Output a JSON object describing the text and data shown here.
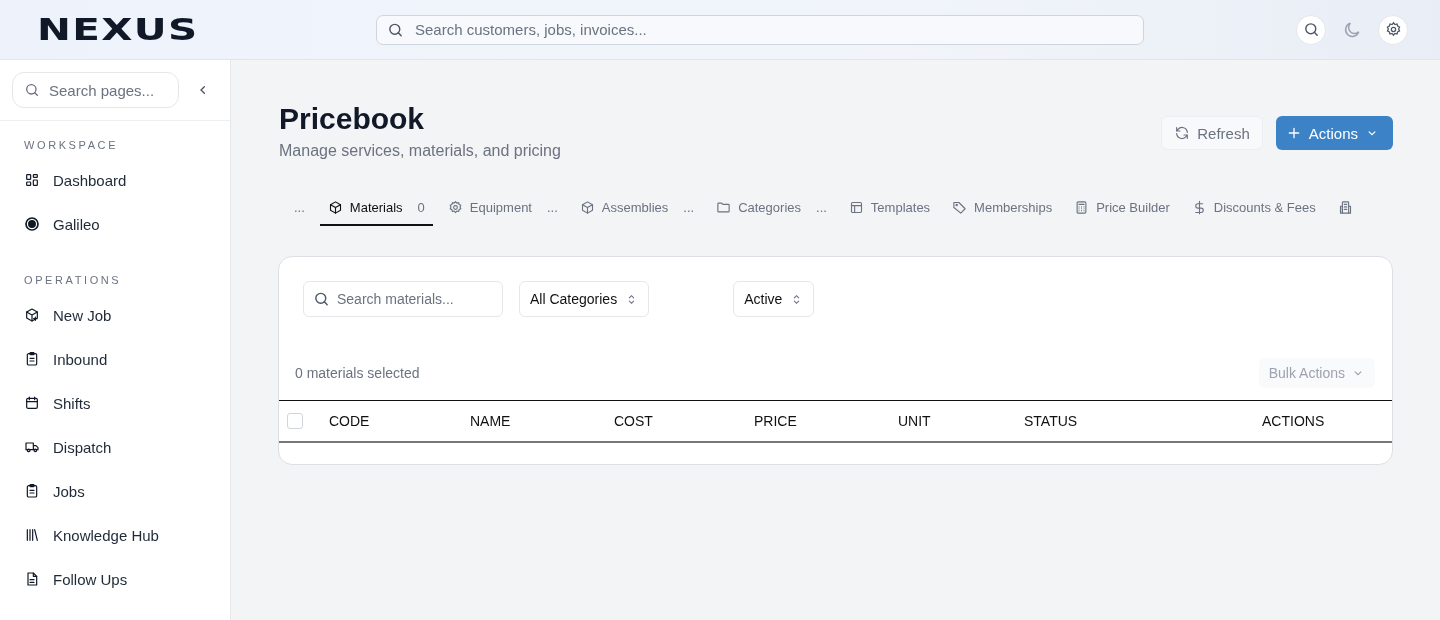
{
  "header": {
    "logo": "NEXUS",
    "search": {
      "placeholder": "Search customers, jobs, invoices..."
    }
  },
  "sidebar": {
    "search": {
      "placeholder": "Search pages..."
    },
    "sections": [
      {
        "title": "WORKSPACE",
        "items": [
          {
            "label": "Dashboard"
          },
          {
            "label": "Galileo"
          }
        ]
      },
      {
        "title": "OPERATIONS",
        "items": [
          {
            "label": "New Job"
          },
          {
            "label": "Inbound"
          },
          {
            "label": "Shifts"
          },
          {
            "label": "Dispatch"
          },
          {
            "label": "Jobs"
          },
          {
            "label": "Knowledge Hub"
          },
          {
            "label": "Follow Ups"
          }
        ]
      }
    ]
  },
  "page": {
    "title": "Pricebook",
    "subtitle": "Manage services, materials, and pricing",
    "buttons": [
      {
        "label": "Refresh",
        "kind": "secondary"
      },
      {
        "label": "Actions",
        "kind": "primary"
      }
    ]
  },
  "tabs": [
    {
      "count": "...",
      "selected": false
    },
    {
      "label": "Materials",
      "count": "0",
      "selected": true
    },
    {
      "label": "Equipment",
      "count": "...",
      "selected": false
    },
    {
      "label": "Assemblies",
      "count": "...",
      "selected": false
    },
    {
      "label": "Categories",
      "count": "...",
      "selected": false
    },
    {
      "label": "Templates",
      "selected": false
    },
    {
      "label": "Memberships",
      "selected": false
    },
    {
      "label": "Price Builder",
      "selected": false
    },
    {
      "label": "Discounts & Fees",
      "selected": false
    },
    {
      "selected": false
    }
  ],
  "filters": {
    "search": {
      "placeholder": "Search materials..."
    },
    "category": "All Categories",
    "status": "Active"
  },
  "selection": {
    "text": "0 materials selected",
    "bulk_button": "Bulk Actions",
    "bulk_disabled": true
  },
  "table": {
    "select_all_checked": false,
    "columns": [
      "CODE",
      "NAME",
      "COST",
      "PRICE",
      "UNIT",
      "STATUS",
      "ACTIONS"
    ]
  }
}
